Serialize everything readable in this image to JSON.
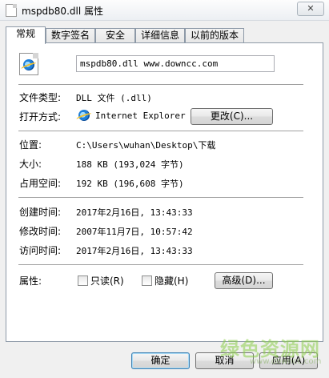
{
  "window": {
    "title": "mspdb80.dll 属性",
    "close_glyph": "✕"
  },
  "tabs": [
    "常规",
    "数字签名",
    "安全",
    "详细信息",
    "以前的版本"
  ],
  "general": {
    "file_name": "mspdb80.dll  www.downcc.com",
    "type_label": "文件类型:",
    "type_value": "DLL 文件 (.dll)",
    "opens_label": "打开方式:",
    "opens_value": "Internet Explorer",
    "change_button": "更改(C)...",
    "location_label": "位置:",
    "location_value": "C:\\Users\\wuhan\\Desktop\\下载",
    "size_label": "大小:",
    "size_value": "188 KB (193,024 字节)",
    "disk_label": "占用空间:",
    "disk_value": "192 KB (196,608 字节)",
    "created_label": "创建时间:",
    "created_value": "2017年2月16日, 13:43:33",
    "modified_label": "修改时间:",
    "modified_value": "2007年11月7日, 10:57:42",
    "accessed_label": "访问时间:",
    "accessed_value": "2017年2月16日, 13:43:33",
    "attr_label": "属性:",
    "readonly_label": "只读(R)",
    "readonly_checked": false,
    "hidden_label": "隐藏(H)",
    "hidden_checked": false,
    "advanced_button": "高级(D)..."
  },
  "footer": {
    "ok": "确定",
    "cancel": "取消",
    "apply": "应用(A)"
  },
  "watermark": {
    "text": "绿色资源网",
    "url": "www.downcc.com"
  }
}
